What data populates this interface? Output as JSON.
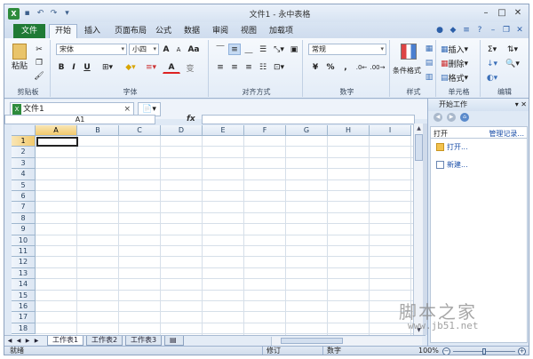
{
  "titlebar": {
    "title": "文件1 - 永中表格",
    "undo_icon": "undo-icon",
    "redo_icon": "redo-icon",
    "save_icon": "save-icon"
  },
  "tabs": [
    "文件",
    "开始",
    "插入",
    "页面布局",
    "公式",
    "数据",
    "审阅",
    "视图",
    "加载项"
  ],
  "ribbon": {
    "clipboard": {
      "label": "剪贴板",
      "paste": "粘贴"
    },
    "font": {
      "label": "字体",
      "font_name": "宋体",
      "font_size": "小四",
      "grow": "A",
      "shrink": "A",
      "case": "Aa",
      "bold": "B",
      "italic": "I",
      "underline": "U",
      "border_icon": "border-icon",
      "fill_icon": "fill-color-icon",
      "color": "A",
      "phonetic": "变"
    },
    "alignment": {
      "label": "对齐方式"
    },
    "number": {
      "label": "数字",
      "format": "常规",
      "currency": "¥",
      "percent": "%",
      "comma": ","
    },
    "styles": {
      "label": "样式",
      "conditional": "条件格式"
    },
    "cells": {
      "label": "单元格",
      "insert": "插入",
      "delete": "删除",
      "format": "格式"
    },
    "editing": {
      "label": "编辑",
      "sum": "Σ"
    }
  },
  "doc_tab": {
    "name": "文件1",
    "close": "×"
  },
  "formula_bar": {
    "cell_ref": "A1",
    "fx": "fx",
    "value": ""
  },
  "sheet": {
    "columns": [
      "A",
      "B",
      "C",
      "D",
      "E",
      "F",
      "G",
      "H",
      "I"
    ],
    "rows": [
      "1",
      "2",
      "3",
      "4",
      "5",
      "6",
      "7",
      "8",
      "9",
      "10",
      "11",
      "12",
      "13",
      "14",
      "15",
      "16",
      "17",
      "18"
    ],
    "active_cell": "A1"
  },
  "sheet_tabs": [
    "工作表1",
    "工作表2",
    "工作表3"
  ],
  "task_pane": {
    "title": "开始工作",
    "open_heading": "打开",
    "manage": "管理记录...",
    "open_link": "打开...",
    "new_link": "新建..."
  },
  "status": {
    "ready": "就绪",
    "revise": "修订",
    "numlock": "数字",
    "zoom": "100%"
  },
  "watermark": {
    "cn": "脚本之家",
    "url": "www.jb51.net"
  }
}
